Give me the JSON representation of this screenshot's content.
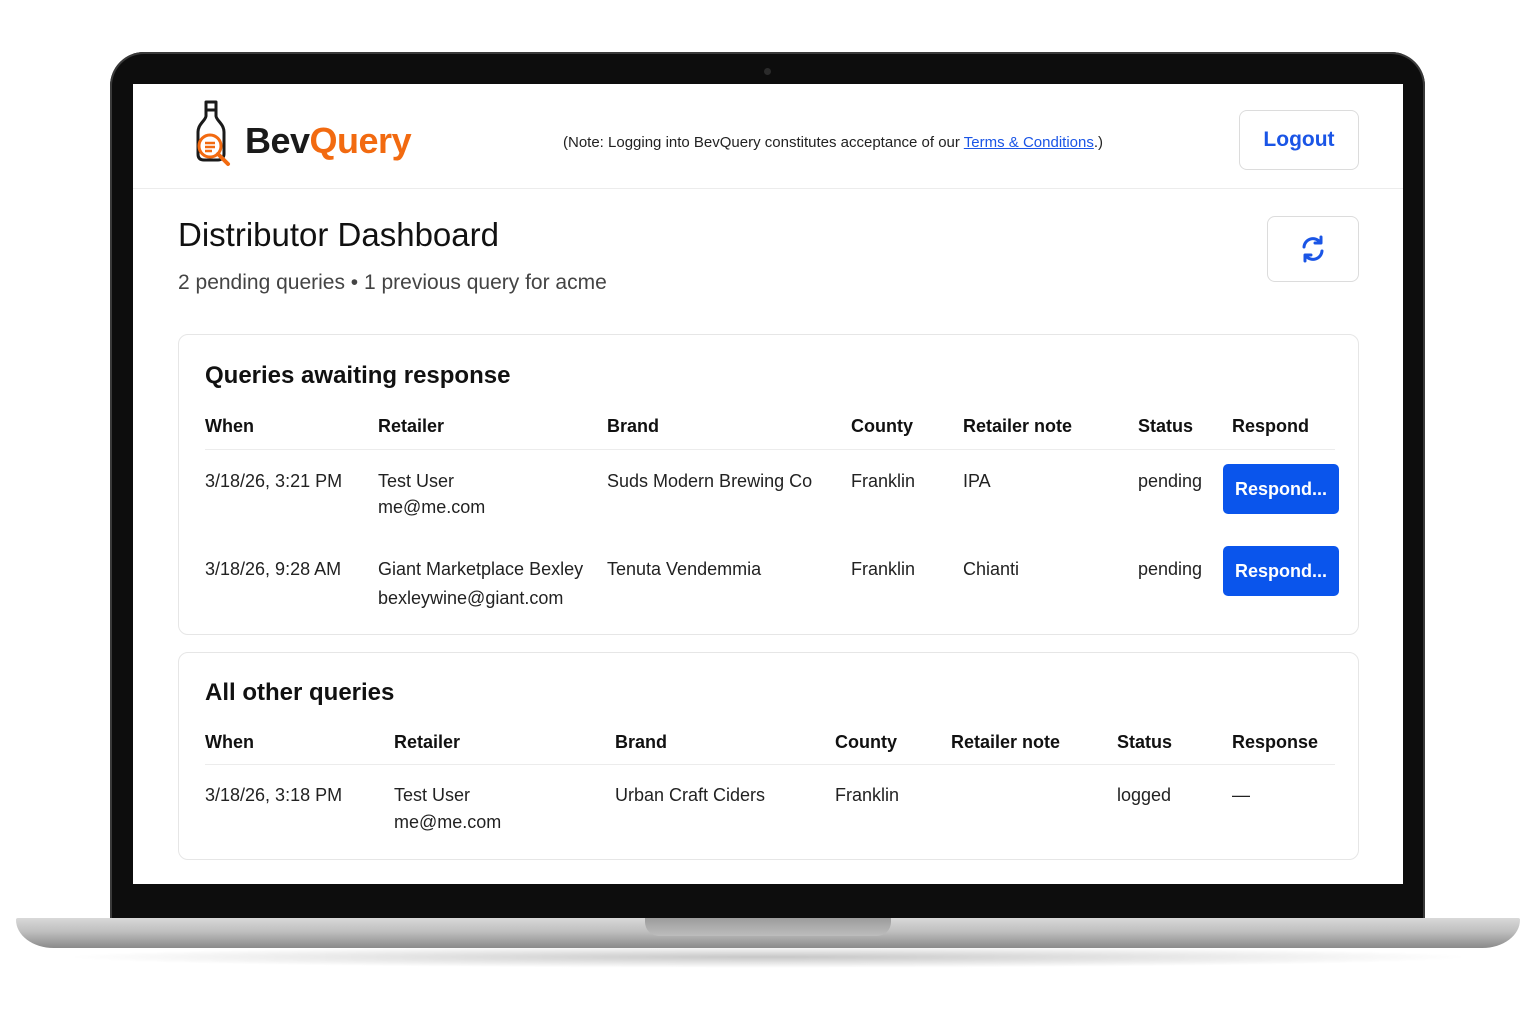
{
  "app": {
    "name_part1": "Bev",
    "name_part2": "Query",
    "note_prefix": "(Note: Logging into BevQuery constitutes acceptance of our ",
    "note_link": "Terms & Conditions",
    "note_suffix": ".)",
    "logout_label": "Logout"
  },
  "page": {
    "title": "Distributor Dashboard",
    "subtitle": "2 pending queries • 1 previous query for acme",
    "refresh_icon": "refresh-icon"
  },
  "pending": {
    "title": "Queries awaiting response",
    "headers": [
      "When",
      "Retailer",
      "Brand",
      "County",
      "Retailer note",
      "Status",
      "Respond"
    ],
    "rows": [
      {
        "when": "3/18/26, 3:21 PM",
        "retailer": "Test User",
        "email": "me@me.com",
        "brand": "Suds Modern Brewing Co",
        "county": "Franklin",
        "note": "IPA",
        "status": "pending",
        "action": "Respond..."
      },
      {
        "when": "3/18/26, 9:28 AM",
        "retailer": "Giant Marketplace Bexley",
        "email": "bexleywine@giant.com",
        "brand": "Tenuta Vendemmia",
        "county": "Franklin",
        "note": "Chianti",
        "status": "pending",
        "action": "Respond..."
      }
    ]
  },
  "other": {
    "title": "All other queries",
    "headers": [
      "When",
      "Retailer",
      "Brand",
      "County",
      "Retailer note",
      "Status",
      "Response"
    ],
    "rows": [
      {
        "when": "3/18/26, 3:18 PM",
        "retailer": "Test User",
        "email": "me@me.com",
        "brand": "Urban Craft Ciders",
        "county": "Franklin",
        "note": "",
        "status": "logged",
        "response": "—"
      }
    ]
  },
  "colors": {
    "accent_blue": "#0a55ec",
    "brand_orange": "#f26a10"
  }
}
